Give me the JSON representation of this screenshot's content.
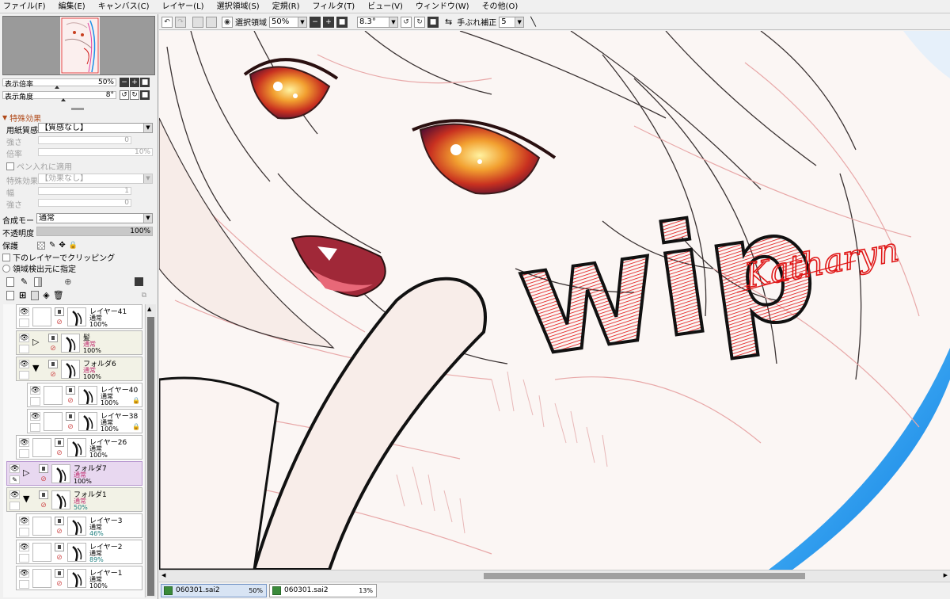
{
  "menu": [
    "ファイル(F)",
    "編集(E)",
    "キャンバス(C)",
    "レイヤー(L)",
    "選択領域(S)",
    "定規(R)",
    "フィルタ(T)",
    "ビュー(V)",
    "ウィンドウ(W)",
    "その他(O)"
  ],
  "navigator": {
    "zoom_label": "表示倍率",
    "zoom_value": "50%",
    "zoom_fraction": 0.5,
    "angle_label": "表示角度",
    "angle_value": "8°",
    "angle_fraction": 0.52
  },
  "effects": {
    "header": "特殊効果",
    "paper_label": "用紙質感",
    "paper_value": "【質感なし】",
    "strength_label": "強さ",
    "strength_value": "0",
    "scale_label": "倍率",
    "scale_value": "10%",
    "brush_apply": "ペン入れに適用",
    "effect_label": "特殊効果",
    "effect_value": "【効果なし】",
    "width_label": "幅",
    "width_value": "1",
    "strength2_label": "強さ",
    "strength2_value": "0"
  },
  "blend": {
    "mode_label": "合成モード",
    "mode_value": "通常",
    "opacity_label": "不透明度",
    "opacity_value": "100%",
    "opacity_fraction": 1.0,
    "protect_label": "保護",
    "clip_label": "下のレイヤーでクリッピング",
    "source_label": "領域検出元に指定"
  },
  "layers": [
    {
      "name": "レイヤー41",
      "mode": "通常",
      "opacity": "100%",
      "indent": 1,
      "type": "layer",
      "selected": false
    },
    {
      "name": "髪",
      "mode": "通常",
      "opacity": "100%",
      "indent": 1,
      "type": "folder",
      "expanded": false,
      "selected": false
    },
    {
      "name": "フォルダ6",
      "mode": "通常",
      "opacity": "100%",
      "indent": 1,
      "type": "folder",
      "expanded": true,
      "selected": false
    },
    {
      "name": "レイヤー40",
      "mode": "通常",
      "opacity": "100%",
      "indent": 2,
      "type": "layer",
      "selected": false
    },
    {
      "name": "レイヤー38",
      "mode": "通常",
      "opacity": "100%",
      "indent": 2,
      "type": "layer",
      "selected": false
    },
    {
      "name": "レイヤー26",
      "mode": "通常",
      "opacity": "100%",
      "indent": 1,
      "type": "layer",
      "selected": false
    },
    {
      "name": "フォルダ7",
      "mode": "通常",
      "opacity": "100%",
      "indent": 0,
      "type": "folder",
      "expanded": false,
      "selected": true
    },
    {
      "name": "フォルダ1",
      "mode": "通常",
      "opacity": "50%",
      "indent": 0,
      "type": "folder",
      "expanded": true,
      "selected": false
    },
    {
      "name": "レイヤー3",
      "mode": "通常",
      "opacity": "46%",
      "indent": 1,
      "type": "layer",
      "selected": false
    },
    {
      "name": "レイヤー2",
      "mode": "通常",
      "opacity": "89%",
      "indent": 1,
      "type": "layer",
      "selected": false
    },
    {
      "name": "レイヤー1",
      "mode": "通常",
      "opacity": "100%",
      "indent": 1,
      "type": "layer",
      "selected": false
    }
  ],
  "toolbar": {
    "select_label": "選択領域",
    "zoom_value": "50%",
    "angle_value": "8.3°",
    "stabilizer_label": "手ぶれ補正",
    "stabilizer_value": "5"
  },
  "canvas_text": {
    "wip": "wip",
    "signature": "Katharyn"
  },
  "tabs": [
    {
      "name": "060301.sai2",
      "zoom": "50%",
      "active": true
    },
    {
      "name": "060301.sai2",
      "zoom": "13%",
      "active": false
    }
  ],
  "colors": {
    "selected_layer": "#e8d8f0",
    "folder_bg": "#f2f2e6",
    "wip_red": "#d81818",
    "accent_blue": "#1a8fe8"
  }
}
